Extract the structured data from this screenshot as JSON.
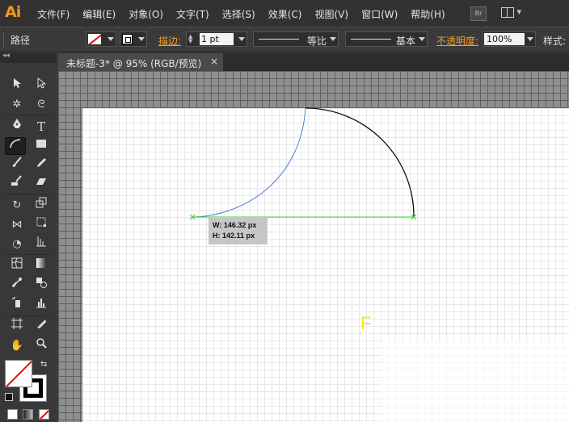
{
  "app": {
    "logo": "Ai"
  },
  "menu": [
    "文件(F)",
    "编辑(E)",
    "对象(O)",
    "文字(T)",
    "选择(S)",
    "效果(C)",
    "视图(V)",
    "窗口(W)",
    "帮助(H)"
  ],
  "menu_right": {
    "bridge": "Br"
  },
  "control_bar": {
    "selection_label": "路径",
    "stroke_label": "描边:",
    "stroke_weight": "1 pt",
    "profile": "等比",
    "brush": "基本",
    "opacity_label": "不透明度:",
    "opacity_value": "100%",
    "style_label": "样式:"
  },
  "toolbox": {
    "collapse": "◂◂"
  },
  "document": {
    "tab_title": "未标题-3* @ 95% (RGB/预览)",
    "close": "×"
  },
  "tooltip": {
    "width": "W: 146.32 px",
    "height": "H: 142.11 px"
  },
  "artboard_text": "F",
  "colors": {
    "accent": "#f0a030",
    "path_selected": "#4a7fd4",
    "smart_guide": "#33cc33",
    "letter": "#f5e61a"
  }
}
